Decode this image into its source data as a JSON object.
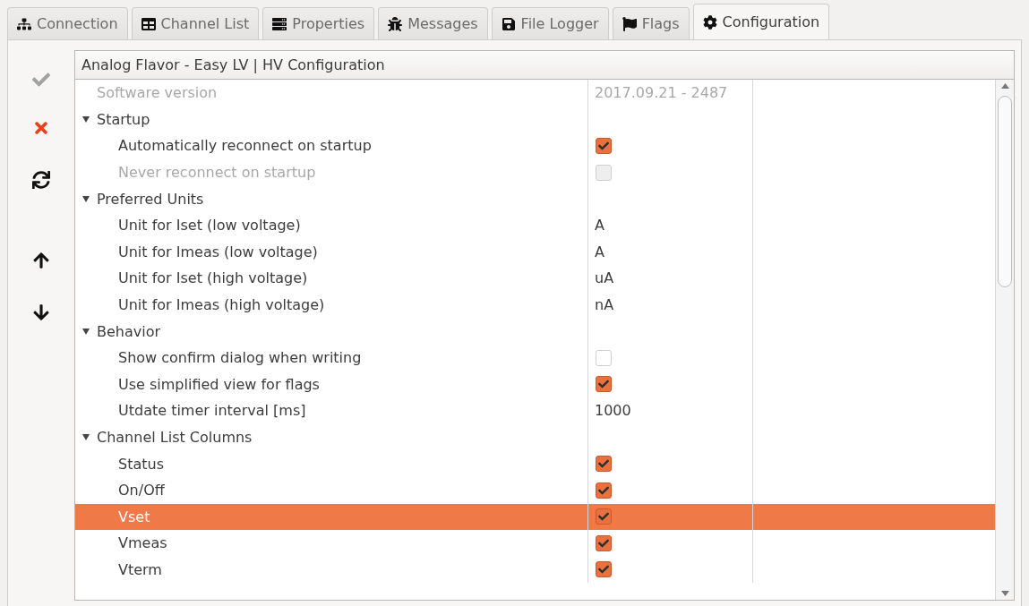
{
  "tabs": [
    {
      "label": "Connection",
      "selected": false
    },
    {
      "label": "Channel List",
      "selected": false
    },
    {
      "label": "Properties",
      "selected": false
    },
    {
      "label": "Messages",
      "selected": false
    },
    {
      "label": "File Logger",
      "selected": false
    },
    {
      "label": "Flags",
      "selected": false
    },
    {
      "label": "Configuration",
      "selected": true
    }
  ],
  "toolbar": [
    {
      "kind": "apply",
      "disabled": true
    },
    {
      "kind": "discard",
      "disabled": false
    },
    {
      "kind": "reload",
      "disabled": false
    },
    {
      "kind": "up",
      "disabled": false
    },
    {
      "kind": "down",
      "disabled": false
    }
  ],
  "tree": {
    "header": "Analog Flavor - Easy LV | HV Configuration",
    "items": [
      {
        "kind": "text",
        "label": "Software version",
        "value": "2017.09.21 - 2487",
        "disabled": true,
        "selected": false
      },
      {
        "kind": "group",
        "label": "Startup",
        "expanded": true,
        "selected": false,
        "children": [
          {
            "kind": "check",
            "label": "Automatically reconnect on startup",
            "checked": true,
            "disabled": false,
            "selected": false
          },
          {
            "kind": "check",
            "label": "Never reconnect on startup",
            "checked": false,
            "disabled": true,
            "selected": false
          }
        ]
      },
      {
        "kind": "group",
        "label": "Preferred Units",
        "expanded": true,
        "selected": false,
        "children": [
          {
            "kind": "text",
            "label": "Unit for Iset (low voltage)",
            "value": "A",
            "disabled": false,
            "selected": false
          },
          {
            "kind": "text",
            "label": "Unit for Imeas (low voltage)",
            "value": "A",
            "disabled": false,
            "selected": false
          },
          {
            "kind": "text",
            "label": "Unit for Iset (high voltage)",
            "value": "uA",
            "disabled": false,
            "selected": false
          },
          {
            "kind": "text",
            "label": "Unit for Imeas (high voltage)",
            "value": "nA",
            "disabled": false,
            "selected": false
          }
        ]
      },
      {
        "kind": "group",
        "label": "Behavior",
        "expanded": true,
        "selected": false,
        "children": [
          {
            "kind": "check",
            "label": "Show confirm dialog when writing",
            "checked": false,
            "disabled": false,
            "selected": false
          },
          {
            "kind": "check",
            "label": "Use simplified view for flags",
            "checked": true,
            "disabled": false,
            "selected": false
          },
          {
            "kind": "text",
            "label": "Utdate timer interval [ms]",
            "value": "1000",
            "disabled": false,
            "selected": false
          }
        ]
      },
      {
        "kind": "group",
        "label": "Channel List Columns",
        "expanded": true,
        "selected": false,
        "children": [
          {
            "kind": "check",
            "label": "Status",
            "checked": true,
            "disabled": false,
            "selected": false
          },
          {
            "kind": "check",
            "label": "On/Off",
            "checked": true,
            "disabled": false,
            "selected": false
          },
          {
            "kind": "check",
            "label": "Vset",
            "checked": true,
            "disabled": false,
            "selected": true
          },
          {
            "kind": "check",
            "label": "Vmeas",
            "checked": true,
            "disabled": false,
            "selected": false
          },
          {
            "kind": "check",
            "label": "Vterm",
            "checked": true,
            "disabled": false,
            "selected": false
          }
        ]
      }
    ]
  }
}
